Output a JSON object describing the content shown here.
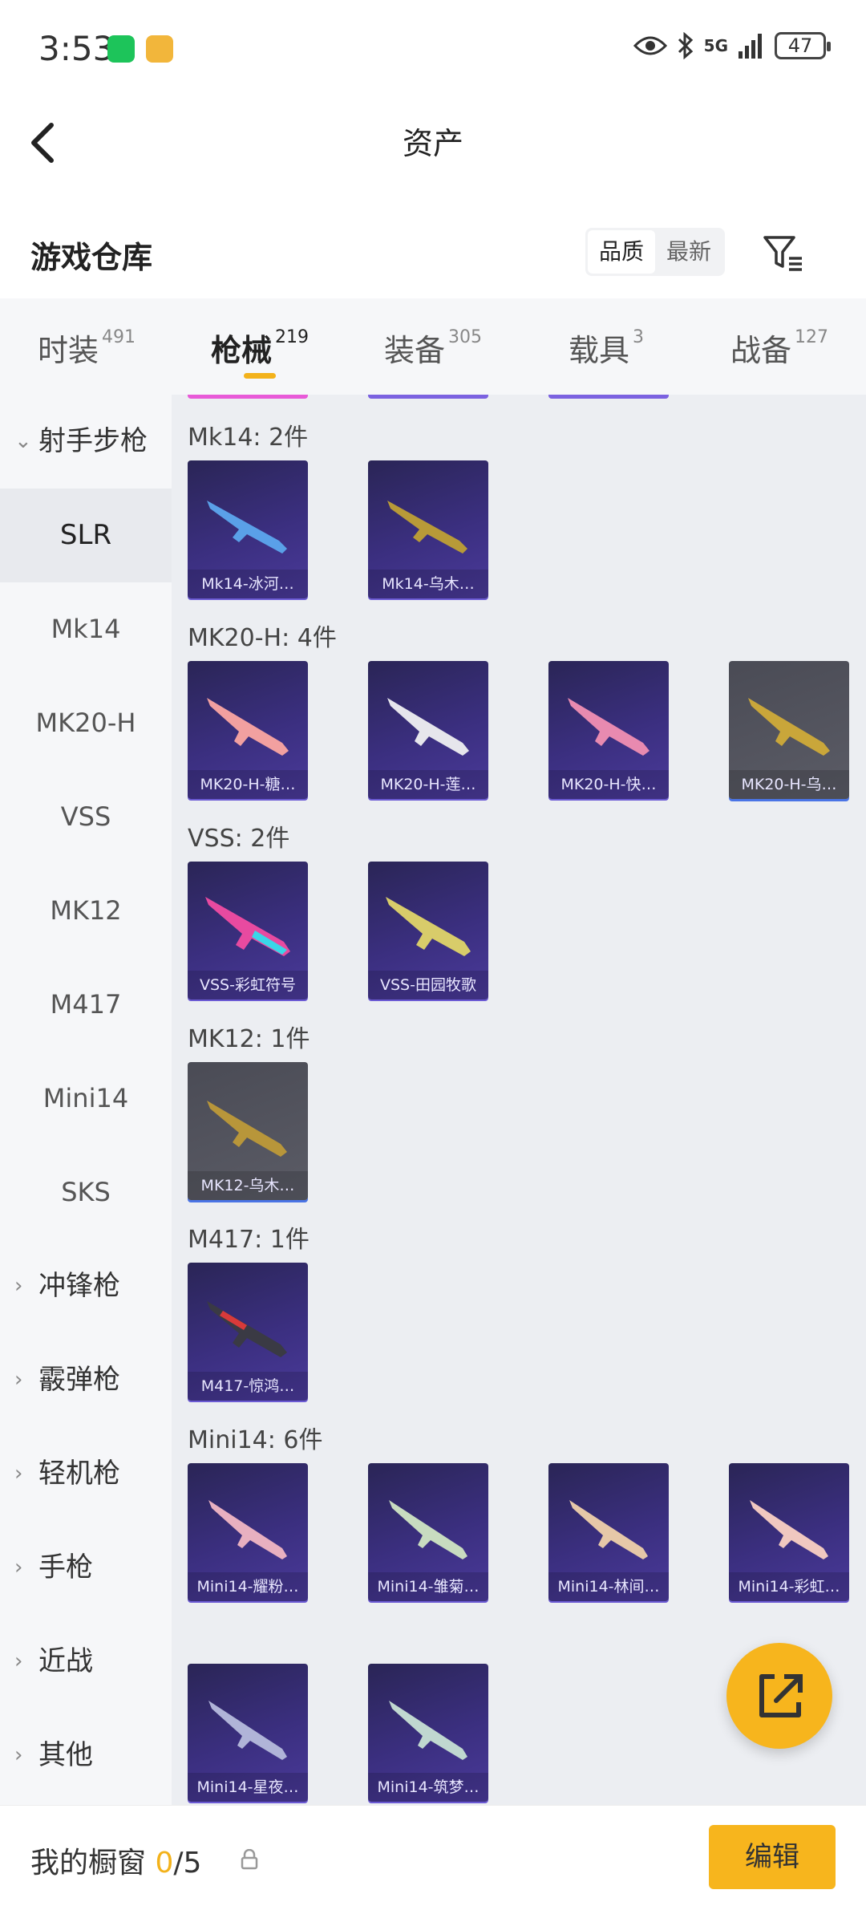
{
  "status_bar": {
    "time": "3:53",
    "network": "5G",
    "battery": "47"
  },
  "header": {
    "title": "资产"
  },
  "section": {
    "title": "游戏仓库",
    "sort_options": [
      "品质",
      "最新"
    ]
  },
  "tabs": [
    {
      "label": "时装",
      "count": "491"
    },
    {
      "label": "枪械",
      "count": "219"
    },
    {
      "label": "装备",
      "count": "305"
    },
    {
      "label": "载具",
      "count": "3"
    },
    {
      "label": "战备",
      "count": "127"
    }
  ],
  "sidebar": {
    "group_open": "射手步枪",
    "items": [
      "SLR",
      "Mk14",
      "MK20-H",
      "VSS",
      "MK12",
      "M417",
      "Mini14",
      "SKS"
    ],
    "groups_closed": [
      "冲锋枪",
      "霰弹枪",
      "轻机枪",
      "手枪",
      "近战",
      "其他"
    ]
  },
  "groups": [
    {
      "title": "Mk14: 2件",
      "items": [
        "Mk14-冰河…",
        "Mk14-乌木…"
      ]
    },
    {
      "title": "MK20-H: 4件",
      "items": [
        "MK20-H-糖…",
        "MK20-H-莲…",
        "MK20-H-快…",
        "MK20-H-乌…"
      ]
    },
    {
      "title": "VSS: 2件",
      "items": [
        "VSS-彩虹符号",
        "VSS-田园牧歌"
      ]
    },
    {
      "title": "MK12: 1件",
      "items": [
        "MK12-乌木…"
      ]
    },
    {
      "title": "M417: 1件",
      "items": [
        "M417-惊鸿…"
      ]
    },
    {
      "title": "Mini14: 6件",
      "items": [
        "Mini14-耀粉…",
        "Mini14-雏菊…",
        "Mini14-林间…",
        "Mini14-彩虹…",
        "Mini14-星夜…",
        "Mini14-筑梦…"
      ]
    }
  ],
  "bottom_bar": {
    "label": "我的橱窗",
    "count": "0",
    "total": "/5",
    "edit_label": "编辑"
  },
  "colors": {
    "accent": "#f7b51d",
    "card_bg": "#3b2f80",
    "card_grey": "#55565f"
  }
}
